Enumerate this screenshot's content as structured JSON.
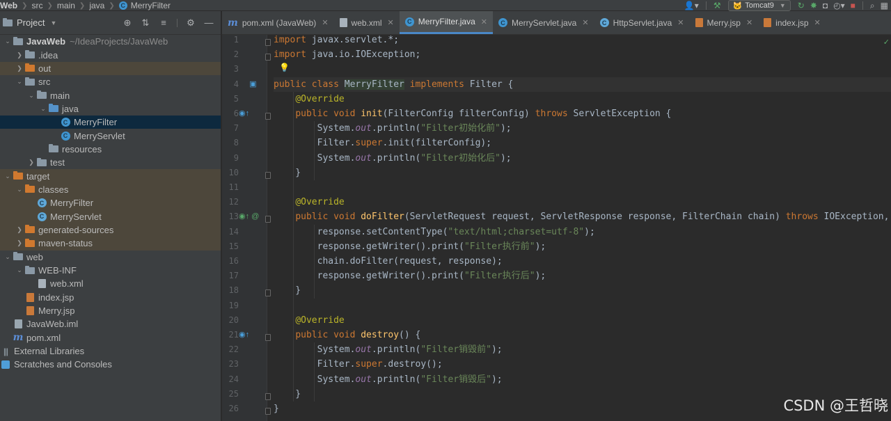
{
  "breadcrumbs": [
    "Web",
    "src",
    "main",
    "java",
    "MerryFilter"
  ],
  "toolbar": {
    "run_config": "Tomcat9"
  },
  "project_panel": {
    "title": "Project",
    "tree": [
      {
        "label": "JavaWeb",
        "path": "~/IdeaProjects/JavaWeb",
        "depth": 0,
        "icon": "folder-gray",
        "toggle": "expanded"
      },
      {
        "label": ".idea",
        "depth": 1,
        "icon": "folder-gray",
        "toggle": "collapsed"
      },
      {
        "label": "out",
        "depth": 1,
        "icon": "folder-orange",
        "toggle": "collapsed",
        "excluded": true
      },
      {
        "label": "src",
        "depth": 1,
        "icon": "folder-gray",
        "toggle": "expanded"
      },
      {
        "label": "main",
        "depth": 2,
        "icon": "folder-gray",
        "toggle": "expanded"
      },
      {
        "label": "java",
        "depth": 3,
        "icon": "folder-blue",
        "toggle": "expanded"
      },
      {
        "label": "MerryFilter",
        "depth": 4,
        "icon": "class",
        "selected": true
      },
      {
        "label": "MerryServlet",
        "depth": 4,
        "icon": "class"
      },
      {
        "label": "resources",
        "depth": 3,
        "icon": "folder-res"
      },
      {
        "label": "test",
        "depth": 2,
        "icon": "folder-gray",
        "toggle": "collapsed"
      },
      {
        "label": "target",
        "depth": 0,
        "icon": "folder-orange",
        "toggle": "expanded",
        "excluded": true
      },
      {
        "label": "classes",
        "depth": 1,
        "icon": "folder-orange",
        "toggle": "expanded",
        "excluded": true
      },
      {
        "label": "MerryFilter",
        "depth": 2,
        "icon": "class-ghost",
        "excluded": true
      },
      {
        "label": "MerryServlet",
        "depth": 2,
        "icon": "class-ghost",
        "excluded": true
      },
      {
        "label": "generated-sources",
        "depth": 1,
        "icon": "folder-orange",
        "toggle": "collapsed",
        "excluded": true
      },
      {
        "label": "maven-status",
        "depth": 1,
        "icon": "folder-orange",
        "toggle": "collapsed",
        "excluded": true
      },
      {
        "label": "web",
        "depth": 0,
        "icon": "folder-gray",
        "toggle": "expanded"
      },
      {
        "label": "WEB-INF",
        "depth": 1,
        "icon": "folder-gray",
        "toggle": "expanded"
      },
      {
        "label": "web.xml",
        "depth": 2,
        "icon": "file-xml"
      },
      {
        "label": "index.jsp",
        "depth": 1,
        "icon": "file-jsp"
      },
      {
        "label": "Merry.jsp",
        "depth": 1,
        "icon": "file-jsp"
      },
      {
        "label": "JavaWeb.iml",
        "depth": 0,
        "icon": "file-iml"
      },
      {
        "label": "pom.xml",
        "depth": 0,
        "icon": "maven"
      },
      {
        "label": "External Libraries",
        "depth": -1,
        "icon": "libraries"
      },
      {
        "label": "Scratches and Consoles",
        "depth": -1,
        "icon": "scratches"
      }
    ]
  },
  "tabs": [
    {
      "label": "pom.xml (JavaWeb)",
      "icon": "maven",
      "active": false
    },
    {
      "label": "web.xml",
      "icon": "file-xml",
      "active": false
    },
    {
      "label": "MerryFilter.java",
      "icon": "class",
      "active": true
    },
    {
      "label": "MerryServlet.java",
      "icon": "class",
      "active": false
    },
    {
      "label": "HttpServlet.java",
      "icon": "class-lib",
      "active": false
    },
    {
      "label": "Merry.jsp",
      "icon": "file-jsp",
      "active": false
    },
    {
      "label": "index.jsp",
      "icon": "file-jsp",
      "active": false
    }
  ],
  "editor": {
    "line_numbers": [
      "1",
      "2",
      "3",
      "4",
      "5",
      "6",
      "7",
      "8",
      "9",
      "10",
      "11",
      "12",
      "13",
      "14",
      "15",
      "16",
      "17",
      "18",
      "19",
      "20",
      "21",
      "22",
      "23",
      "24",
      "25",
      "26"
    ],
    "lines": [
      [
        [
          "kw",
          "import"
        ],
        [
          "p",
          " javax.servlet.*;"
        ]
      ],
      [
        [
          "kw",
          "import"
        ],
        [
          "p",
          " java.io.IOException;"
        ]
      ],
      [],
      [
        [
          "kw",
          "public class "
        ],
        [
          "hl",
          "MerryFilter"
        ],
        [
          "kw",
          " implements "
        ],
        [
          "p",
          "Filter {"
        ]
      ],
      [
        [
          "p",
          "    "
        ],
        [
          "an",
          "@Override"
        ]
      ],
      [
        [
          "p",
          "    "
        ],
        [
          "kw",
          "public void "
        ],
        [
          "fn",
          "init"
        ],
        [
          "p",
          "(FilterConfig filterConfig) "
        ],
        [
          "kw",
          "throws "
        ],
        [
          "p",
          "ServletException {"
        ]
      ],
      [
        [
          "p",
          "        System."
        ],
        [
          "it",
          "out"
        ],
        [
          "p",
          ".println("
        ],
        [
          "st",
          "\"Filter初始化前\""
        ],
        [
          "p",
          ");"
        ]
      ],
      [
        [
          "p",
          "        Filter."
        ],
        [
          "kw",
          "super"
        ],
        [
          "p",
          ".init(filterConfig);"
        ]
      ],
      [
        [
          "p",
          "        System."
        ],
        [
          "it",
          "out"
        ],
        [
          "p",
          ".println("
        ],
        [
          "st",
          "\"Filter初始化后\""
        ],
        [
          "p",
          ");"
        ]
      ],
      [
        [
          "p",
          "    }"
        ]
      ],
      [],
      [
        [
          "p",
          "    "
        ],
        [
          "an",
          "@Override"
        ]
      ],
      [
        [
          "p",
          "    "
        ],
        [
          "kw",
          "public void "
        ],
        [
          "fn",
          "doFilter"
        ],
        [
          "p",
          "(ServletRequest request, ServletResponse response, FilterChain chain) "
        ],
        [
          "kw",
          "throws "
        ],
        [
          "p",
          "IOException, Servl"
        ]
      ],
      [
        [
          "p",
          "        response.setContentType("
        ],
        [
          "st",
          "\"text/html;charset=utf-8\""
        ],
        [
          "p",
          ");"
        ]
      ],
      [
        [
          "p",
          "        response.getWriter().print("
        ],
        [
          "st",
          "\"Filter执行前\""
        ],
        [
          "p",
          ");"
        ]
      ],
      [
        [
          "p",
          "        chain.doFilter(request, response);"
        ]
      ],
      [
        [
          "p",
          "        response.getWriter().print("
        ],
        [
          "st",
          "\"Filter执行后\""
        ],
        [
          "p",
          ");"
        ]
      ],
      [
        [
          "p",
          "    }"
        ]
      ],
      [],
      [
        [
          "p",
          "    "
        ],
        [
          "an",
          "@Override"
        ]
      ],
      [
        [
          "p",
          "    "
        ],
        [
          "kw",
          "public void "
        ],
        [
          "fn",
          "destroy"
        ],
        [
          "p",
          "() {"
        ]
      ],
      [
        [
          "p",
          "        System."
        ],
        [
          "it",
          "out"
        ],
        [
          "p",
          ".println("
        ],
        [
          "st",
          "\"Filter销毁前\""
        ],
        [
          "p",
          ");"
        ]
      ],
      [
        [
          "p",
          "        Filter."
        ],
        [
          "kw",
          "super"
        ],
        [
          "p",
          ".destroy();"
        ]
      ],
      [
        [
          "p",
          "        System."
        ],
        [
          "it",
          "out"
        ],
        [
          "p",
          ".println("
        ],
        [
          "st",
          "\"Filter销毁后\""
        ],
        [
          "p",
          ");"
        ]
      ],
      [
        [
          "p",
          "    }"
        ]
      ],
      [
        [
          "p",
          "}"
        ]
      ]
    ]
  },
  "watermark": "CSDN @王哲晓",
  "colors": {
    "keyword": "#cc7832",
    "annotation": "#bbb529",
    "string": "#6a8759",
    "method": "#ffc66d",
    "static_field": "#9876aa",
    "plain": "#a9b7c6",
    "selection": "#0d293e",
    "excluded": "#4d473b"
  }
}
